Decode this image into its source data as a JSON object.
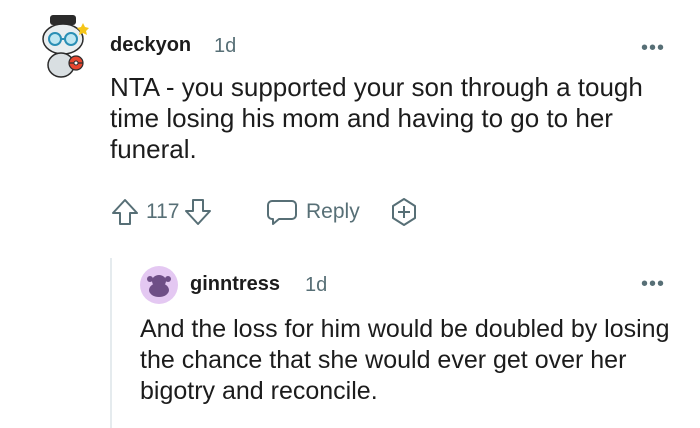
{
  "comment": {
    "username": "deckyon",
    "age": "1d",
    "more": "•••",
    "text": "NTA - you supported your son through a tough time losing his mom and having to go to her funeral.",
    "score": "117",
    "reply_label": "Reply"
  },
  "reply": {
    "username": "ginntress",
    "age": "1d",
    "more": "•••",
    "text": "And the loss for him would be doubled by losing the chance that she would ever get over her bigotry and reconcile."
  },
  "colors": {
    "meta": "#576f76",
    "text": "#1c1c1c",
    "avatar_purple": "#b58bd6"
  },
  "icons": {
    "upvote": "upvote-arrow-icon",
    "downvote": "downvote-arrow-icon",
    "reply": "speech-bubble-icon",
    "award": "add-award-icon",
    "more": "more-options-icon"
  }
}
